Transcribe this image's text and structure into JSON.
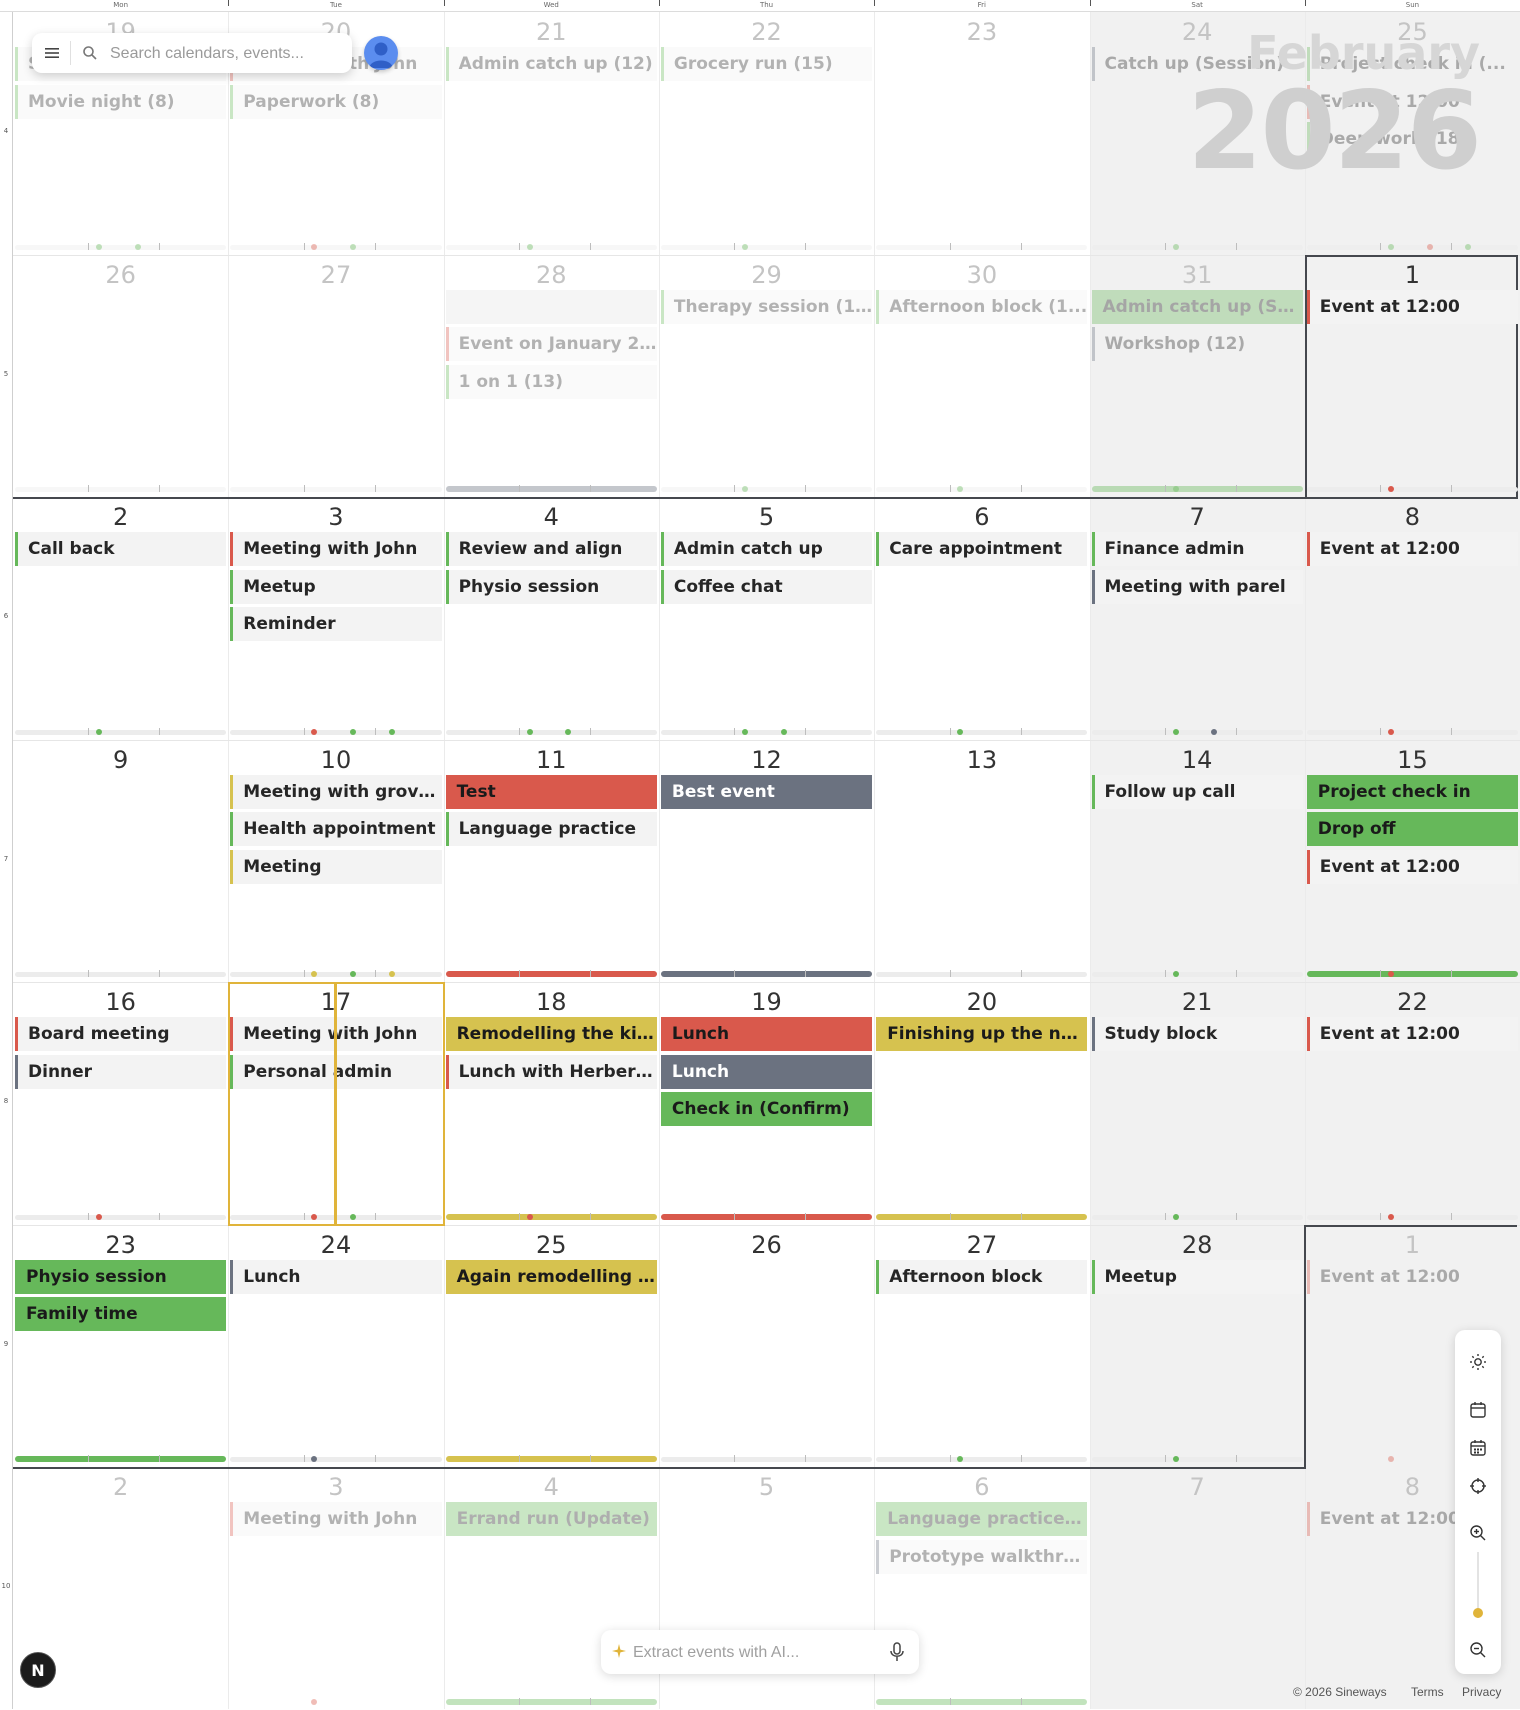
{
  "day_headers": [
    "Mon",
    "Tue",
    "Wed",
    "Thu",
    "Fri",
    "Sat",
    "Sun"
  ],
  "week_numbers": [
    "4",
    "5",
    "6",
    "7",
    "8",
    "9",
    "10"
  ],
  "header": {
    "month": "February",
    "year": "2026"
  },
  "search": {
    "placeholder": "Search calendars, events..."
  },
  "ai_bar": {
    "placeholder": "Extract events with AI..."
  },
  "footer": {
    "copyright": "© 2026 Sineways",
    "terms": "Terms",
    "privacy": "Privacy"
  },
  "badge": {
    "label": "N"
  },
  "colors": {
    "red": "#d9594c",
    "green": "#66b85a",
    "yellow": "#d6c24f",
    "gray": "#6b7280",
    "today": "#e0b43a"
  },
  "toolbar_icons": [
    "sun-icon",
    "calendar-icon",
    "calendar-grid-icon",
    "crosshair-icon",
    "zoom-in-icon",
    "zoom-out-icon"
  ],
  "weeks": [
    [
      {
        "day": "19",
        "faded": true,
        "events": [
          {
            "title": "Study",
            "color": "#66b85a"
          },
          {
            "title": "Movie night (8)",
            "color": "#66b85a"
          }
        ],
        "bar": "plain",
        "dots": [
          "#66b85a",
          "#66b85a"
        ]
      },
      {
        "day": "20",
        "faded": true,
        "events": [
          {
            "title": "Meeting with John",
            "color": "#d9594c"
          },
          {
            "title": "Paperwork (8)",
            "color": "#66b85a"
          }
        ],
        "bar": "plain",
        "dots": [
          "#d9594c",
          "#66b85a"
        ]
      },
      {
        "day": "21",
        "faded": true,
        "events": [
          {
            "title": "Admin catch up (12)",
            "color": "#66b85a"
          }
        ],
        "bar": "plain",
        "dots": [
          "#66b85a"
        ]
      },
      {
        "day": "22",
        "faded": true,
        "events": [
          {
            "title": "Grocery run (15)",
            "color": "#66b85a"
          }
        ],
        "bar": "plain",
        "dots": [
          "#66b85a"
        ]
      },
      {
        "day": "23",
        "faded": true,
        "events": [],
        "bar": "plain",
        "dots": []
      },
      {
        "day": "24",
        "faded": true,
        "events": [
          {
            "title": "Catch up (Session)",
            "color": "#6b7280"
          }
        ],
        "bar": "plain",
        "dots": [
          "#66b85a"
        ]
      },
      {
        "day": "25",
        "faded": true,
        "events": [
          {
            "title": "Project check in (...",
            "color": "#66b85a"
          },
          {
            "title": "Event at 12:00",
            "color": "#d9594c"
          },
          {
            "title": "Deep work (18)",
            "color": "#66b85a"
          }
        ],
        "bar": "plain",
        "dots": [
          "#66b85a",
          "#d9594c",
          "#66b85a"
        ]
      }
    ],
    [
      {
        "day": "26",
        "faded": true,
        "events": [],
        "bar": "plain",
        "dots": []
      },
      {
        "day": "27",
        "faded": true,
        "events": [],
        "bar": "plain",
        "dots": []
      },
      {
        "day": "28",
        "faded": true,
        "events": [
          {
            "title": "",
            "color": "#6b7280",
            "filled": true
          },
          {
            "title": "Event on January 2...",
            "color": "#d9594c"
          },
          {
            "title": "1 on 1 (13)",
            "color": "#66b85a"
          }
        ],
        "bar": "gray",
        "dots": []
      },
      {
        "day": "29",
        "faded": true,
        "events": [
          {
            "title": "Therapy session (1...",
            "color": "#66b85a"
          }
        ],
        "bar": "plain",
        "dots": [
          "#66b85a"
        ]
      },
      {
        "day": "30",
        "faded": true,
        "events": [
          {
            "title": "Afternoon block (1...",
            "color": "#66b85a"
          }
        ],
        "bar": "plain",
        "dots": [
          "#66b85a"
        ]
      },
      {
        "day": "31",
        "faded": true,
        "events": [
          {
            "title": "Admin catch up (Ses...",
            "color": "#66b85a",
            "filled": true
          },
          {
            "title": "Workshop (12)",
            "color": "#6b7280"
          }
        ],
        "bar": "green",
        "dots": [
          "#66b85a"
        ]
      },
      {
        "day": "1",
        "faded": false,
        "events": [
          {
            "title": "Event at 12:00",
            "color": "#d9594c"
          }
        ],
        "bar": "plain",
        "dots": [
          "#d9594c"
        ]
      }
    ],
    [
      {
        "day": "2",
        "faded": false,
        "events": [
          {
            "title": "Call back",
            "color": "#66b85a"
          }
        ],
        "bar": "plain",
        "dots": [
          "#66b85a"
        ]
      },
      {
        "day": "3",
        "faded": false,
        "events": [
          {
            "title": "Meeting with John",
            "color": "#d9594c"
          },
          {
            "title": "Meetup",
            "color": "#66b85a"
          },
          {
            "title": "Reminder",
            "color": "#66b85a"
          }
        ],
        "bar": "plain",
        "dots": [
          "#d9594c",
          "#66b85a",
          "#66b85a"
        ]
      },
      {
        "day": "4",
        "faded": false,
        "events": [
          {
            "title": "Review and align",
            "color": "#66b85a"
          },
          {
            "title": "Physio session",
            "color": "#66b85a"
          }
        ],
        "bar": "plain",
        "dots": [
          "#66b85a",
          "#66b85a"
        ]
      },
      {
        "day": "5",
        "faded": false,
        "events": [
          {
            "title": "Admin catch up",
            "color": "#66b85a"
          },
          {
            "title": "Coffee chat",
            "color": "#66b85a"
          }
        ],
        "bar": "plain",
        "dots": [
          "#66b85a",
          "#66b85a"
        ]
      },
      {
        "day": "6",
        "faded": false,
        "events": [
          {
            "title": "Care appointment",
            "color": "#66b85a"
          }
        ],
        "bar": "plain",
        "dots": [
          "#66b85a"
        ]
      },
      {
        "day": "7",
        "faded": false,
        "events": [
          {
            "title": "Finance admin",
            "color": "#66b85a"
          },
          {
            "title": "Meeting with parel",
            "color": "#6b7280"
          }
        ],
        "bar": "plain",
        "dots": [
          "#66b85a",
          "#6b7280"
        ]
      },
      {
        "day": "8",
        "faded": false,
        "events": [
          {
            "title": "Event at 12:00",
            "color": "#d9594c"
          }
        ],
        "bar": "plain",
        "dots": [
          "#d9594c"
        ]
      }
    ],
    [
      {
        "day": "9",
        "faded": false,
        "events": [],
        "bar": "plain",
        "dots": []
      },
      {
        "day": "10",
        "faded": false,
        "events": [
          {
            "title": "Meeting with grove...",
            "color": "#d6c24f"
          },
          {
            "title": "Health appointment",
            "color": "#66b85a"
          },
          {
            "title": "Meeting",
            "color": "#d6c24f"
          }
        ],
        "bar": "plain",
        "dots": [
          "#d6c24f",
          "#66b85a",
          "#d6c24f"
        ]
      },
      {
        "day": "11",
        "faded": false,
        "events": [
          {
            "title": "Test",
            "color": "#d9594c",
            "filled": true
          },
          {
            "title": "Language practice",
            "color": "#66b85a"
          }
        ],
        "bar": "red",
        "dots": []
      },
      {
        "day": "12",
        "faded": false,
        "events": [
          {
            "title": "Best event",
            "color": "#6b7280",
            "filled": true
          }
        ],
        "bar": "gray",
        "dots": []
      },
      {
        "day": "13",
        "faded": false,
        "events": [],
        "bar": "plain",
        "dots": []
      },
      {
        "day": "14",
        "faded": false,
        "events": [
          {
            "title": "Follow up call",
            "color": "#66b85a"
          }
        ],
        "bar": "plain",
        "dots": [
          "#66b85a"
        ]
      },
      {
        "day": "15",
        "faded": false,
        "events": [
          {
            "title": "Project check in",
            "color": "#66b85a",
            "filled": true
          },
          {
            "title": "Drop off",
            "color": "#66b85a",
            "filled": true
          },
          {
            "title": "Event at 12:00",
            "color": "#d9594c"
          }
        ],
        "bar": "green",
        "dots": [
          "#d9594c"
        ]
      }
    ],
    [
      {
        "day": "16",
        "faded": false,
        "events": [
          {
            "title": "Board meeting",
            "color": "#d9594c"
          },
          {
            "title": "Dinner",
            "color": "#6b7280"
          }
        ],
        "bar": "plain",
        "dots": [
          "#d9594c"
        ]
      },
      {
        "day": "17",
        "faded": false,
        "today": true,
        "events": [
          {
            "title": "Meeting with John",
            "color": "#d9594c"
          },
          {
            "title": "Personal admin",
            "color": "#66b85a"
          }
        ],
        "bar": "plain",
        "dots": [
          "#d9594c",
          "#66b85a"
        ]
      },
      {
        "day": "18",
        "faded": false,
        "events": [
          {
            "title": "Remodelling the kit...",
            "color": "#d6c24f",
            "filled": true
          },
          {
            "title": "Lunch with Herbert...",
            "color": "#d9594c"
          }
        ],
        "bar": "yellow",
        "dots": [
          "#d9594c"
        ]
      },
      {
        "day": "19",
        "faded": false,
        "events": [
          {
            "title": "Lunch",
            "color": "#d9594c",
            "filled": true
          },
          {
            "title": "Lunch",
            "color": "#6b7280",
            "filled": true
          },
          {
            "title": "Check in (Confirm)",
            "color": "#66b85a",
            "filled": true
          }
        ],
        "bar": "red",
        "dots": []
      },
      {
        "day": "20",
        "faded": false,
        "events": [
          {
            "title": "Finishing up the ne...",
            "color": "#d6c24f",
            "filled": true
          }
        ],
        "bar": "yellow",
        "dots": []
      },
      {
        "day": "21",
        "faded": false,
        "events": [
          {
            "title": "Study block",
            "color": "#6b7280"
          }
        ],
        "bar": "plain",
        "dots": [
          "#66b85a"
        ]
      },
      {
        "day": "22",
        "faded": false,
        "events": [
          {
            "title": "Event at 12:00",
            "color": "#d9594c"
          }
        ],
        "bar": "plain",
        "dots": [
          "#d9594c"
        ]
      }
    ],
    [
      {
        "day": "23",
        "faded": false,
        "events": [
          {
            "title": "Physio session",
            "color": "#66b85a",
            "filled": true
          },
          {
            "title": "Family time",
            "color": "#66b85a",
            "filled": true
          }
        ],
        "bar": "green",
        "dots": []
      },
      {
        "day": "24",
        "faded": false,
        "events": [
          {
            "title": "Lunch",
            "color": "#6b7280"
          }
        ],
        "bar": "plain",
        "dots": [
          "#6b7280"
        ]
      },
      {
        "day": "25",
        "faded": false,
        "events": [
          {
            "title": "Again remodelling t...",
            "color": "#d6c24f",
            "filled": true
          }
        ],
        "bar": "yellow",
        "dots": []
      },
      {
        "day": "26",
        "faded": false,
        "events": [],
        "bar": "plain",
        "dots": []
      },
      {
        "day": "27",
        "faded": false,
        "events": [
          {
            "title": "Afternoon block",
            "color": "#66b85a"
          }
        ],
        "bar": "plain",
        "dots": [
          "#66b85a"
        ]
      },
      {
        "day": "28",
        "faded": false,
        "events": [
          {
            "title": "Meetup",
            "color": "#66b85a"
          }
        ],
        "bar": "plain",
        "dots": [
          "#66b85a"
        ]
      },
      {
        "day": "1",
        "faded": true,
        "events": [
          {
            "title": "Event at 12:00",
            "color": "#d9594c"
          }
        ],
        "bar": "none",
        "dots": [
          "#d9594c"
        ]
      }
    ],
    [
      {
        "day": "2",
        "faded": true,
        "events": [],
        "bar": "none",
        "dots": []
      },
      {
        "day": "3",
        "faded": true,
        "events": [
          {
            "title": "Meeting with John",
            "color": "#d9594c"
          }
        ],
        "bar": "none",
        "dots": [
          "#d9594c"
        ]
      },
      {
        "day": "4",
        "faded": true,
        "events": [
          {
            "title": "Errand run (Update)",
            "color": "#66b85a",
            "filled": true
          }
        ],
        "bar": "green",
        "dots": []
      },
      {
        "day": "5",
        "faded": true,
        "events": [],
        "bar": "none",
        "dots": []
      },
      {
        "day": "6",
        "faded": true,
        "events": [
          {
            "title": "Language practice (...",
            "color": "#66b85a",
            "filled": true
          },
          {
            "title": "Prototype walkthro...",
            "color": "#6b7280"
          }
        ],
        "bar": "green",
        "dots": []
      },
      {
        "day": "7",
        "faded": true,
        "events": [],
        "bar": "none",
        "dots": []
      },
      {
        "day": "8",
        "faded": true,
        "events": [
          {
            "title": "Event at 12:00",
            "color": "#d9594c"
          }
        ],
        "bar": "none",
        "dots": []
      }
    ]
  ]
}
